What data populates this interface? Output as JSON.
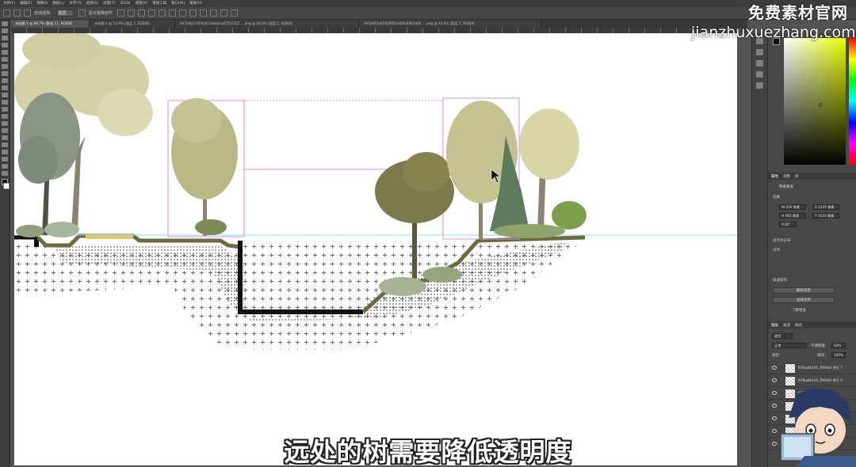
{
  "app": {
    "name": "Photoshop"
  },
  "menu": [
    "文件(F)",
    "编辑(E)",
    "图像(I)",
    "图层(L)",
    "文字(Y)",
    "选择(S)",
    "滤镜(T)",
    "3D(D)",
    "视图(V)",
    "增效工具",
    "窗口(W)",
    "帮助(H)"
  ],
  "options": {
    "auto_select_label": "自动选择:",
    "auto_select_value": "图层",
    "transform_label": "显示变换控件"
  },
  "tabs": [
    {
      "label": "未标题-1 @ 66.7% (群组 11, RGB/8)",
      "active": true
    },
    {
      "label": "未标题-1 @ 13.9% (图层 1, RGB/8)",
      "active": false
    },
    {
      "label": "b07a0b57e594414ebdcac07f52312 ... png @ 46.8% (图层 1, RGB/8)",
      "active": false
    },
    {
      "label": "6e5a963a8192962ca66fa49b5a49 ... png @ 44.4% (图层 1, RGB/8)",
      "active": false
    }
  ],
  "properties": {
    "tabs": [
      "属性",
      "调整",
      "库"
    ],
    "section_label": "像素图层",
    "transform_label": "变换",
    "w_value": "W 250 像素",
    "x_value": "X 1335 像素",
    "h_value": "H 463 像素",
    "y_value": "Y 1033 像素",
    "angle_value": "0.00°",
    "align_label": "对齐并分布",
    "align_sub": "对齐:",
    "quick_label": "快速操作",
    "quick_buttons": [
      "删除背景",
      "选择主体"
    ],
    "more_label": "了解更多"
  },
  "layers_panel": {
    "tabs": [
      "图层",
      "通道",
      "路径"
    ],
    "kind_label": "类型",
    "blend_mode": "正常",
    "opacity_label": "不透明度:",
    "opacity_value": "62%",
    "lock_label": "锁定:",
    "fill_label": "填充:",
    "fill_value": "100%",
    "layers": [
      "97fba8b191_RRAGH 拷贝 7",
      "97fba8b191_RRAGH 拷贝 6",
      "97fba8b191_RRAGH",
      "97fba8b191_RRAGH",
      "97fba8b191_RRAGH",
      "97fba8b191_RRAGH",
      "97fba8b191_RRAGH"
    ]
  },
  "watermark": {
    "title": "免费素材官网",
    "url": "jianzhuxuezhang.com"
  },
  "subtitle": "远处的树需要降低透明度",
  "colors": {
    "accent_cyan": "#7fe0ec",
    "selection_magenta": "#e58ae0",
    "ground_black": "#111111",
    "ground_olive": "#6c6b3d",
    "sand": "#e5c46a"
  }
}
